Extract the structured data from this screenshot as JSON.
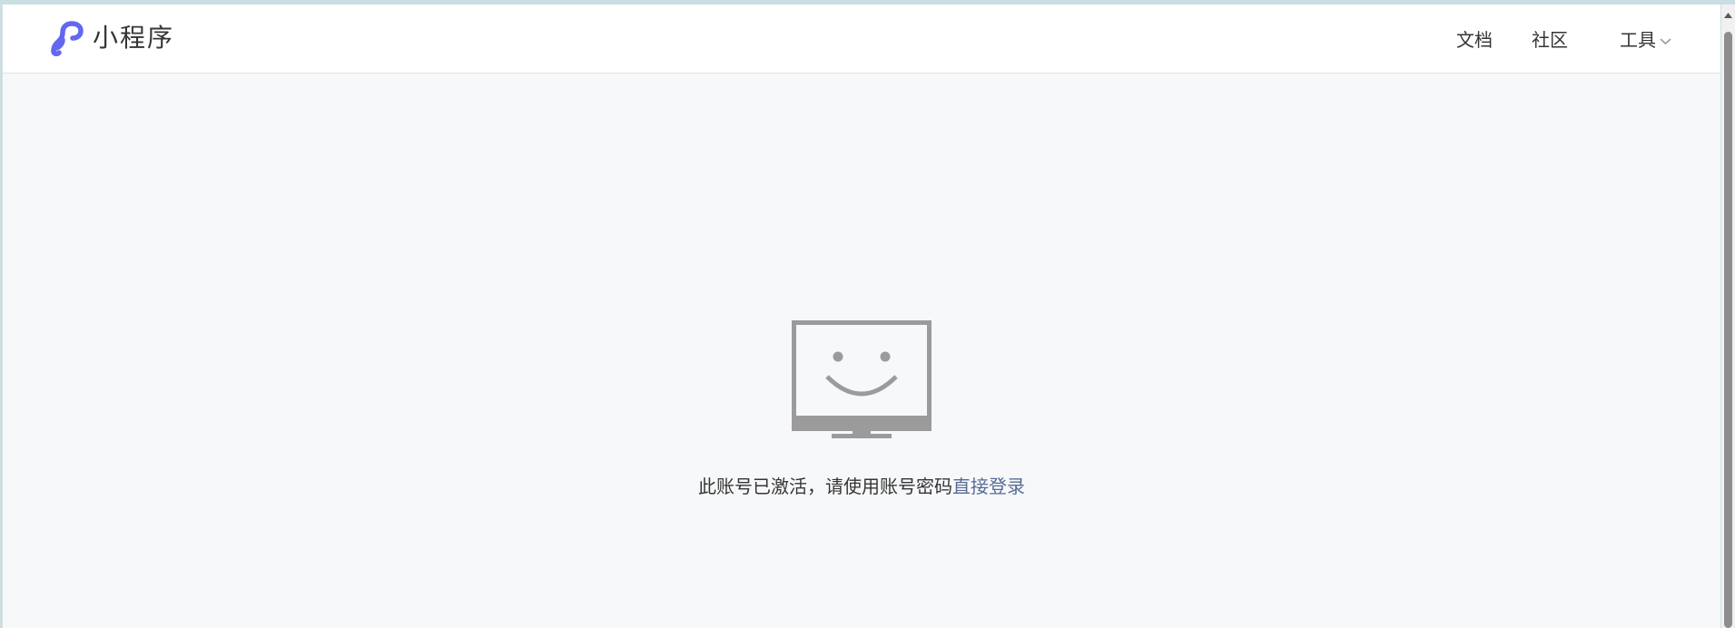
{
  "header": {
    "brand_name": "小程序",
    "logo_icon": "miniprogram-logo-icon",
    "nav": {
      "docs": "文档",
      "community": "社区",
      "tools": "工具"
    },
    "tools_icon": "chevron-down-icon"
  },
  "main": {
    "illustration_icon": "smiling-monitor-icon",
    "message": "此账号已激活，请使用账号密码",
    "link": "直接登录"
  },
  "colors": {
    "brand": "#6467f0",
    "link": "#576b95",
    "icon": "#9b9b9b"
  }
}
